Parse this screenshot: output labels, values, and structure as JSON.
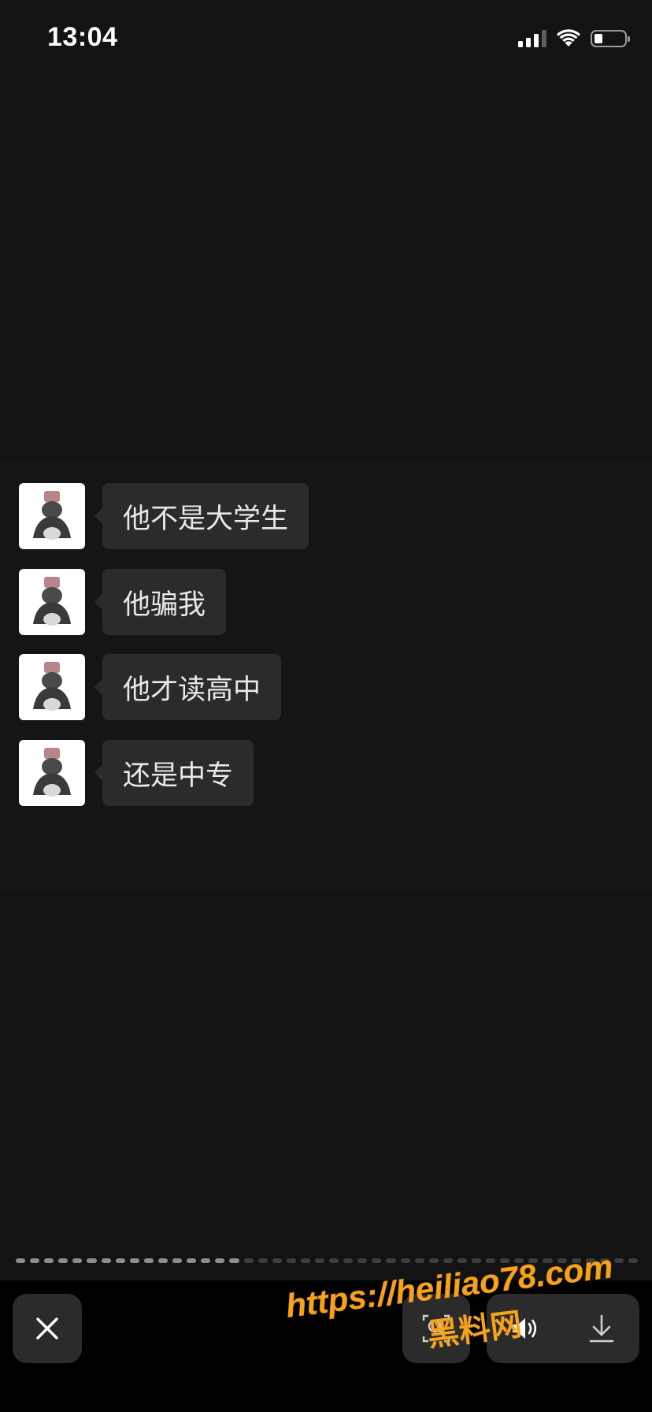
{
  "status_bar": {
    "time": "13:04",
    "signal_bars": 3,
    "battery_level": 0.3
  },
  "chat": {
    "messages": [
      {
        "text": "他不是大学生"
      },
      {
        "text": "他骗我"
      },
      {
        "text": "他才读高中"
      },
      {
        "text": "还是中专"
      }
    ]
  },
  "viewer": {
    "progress": {
      "current": 16,
      "total": 44
    },
    "icons": {
      "close": "close-icon",
      "search": "search-person-icon",
      "audio": "speaker-icon",
      "download": "download-icon"
    }
  },
  "watermark": {
    "url": "https://heiliao78.com",
    "name": "黑料网",
    "color": "#f5a21d"
  }
}
